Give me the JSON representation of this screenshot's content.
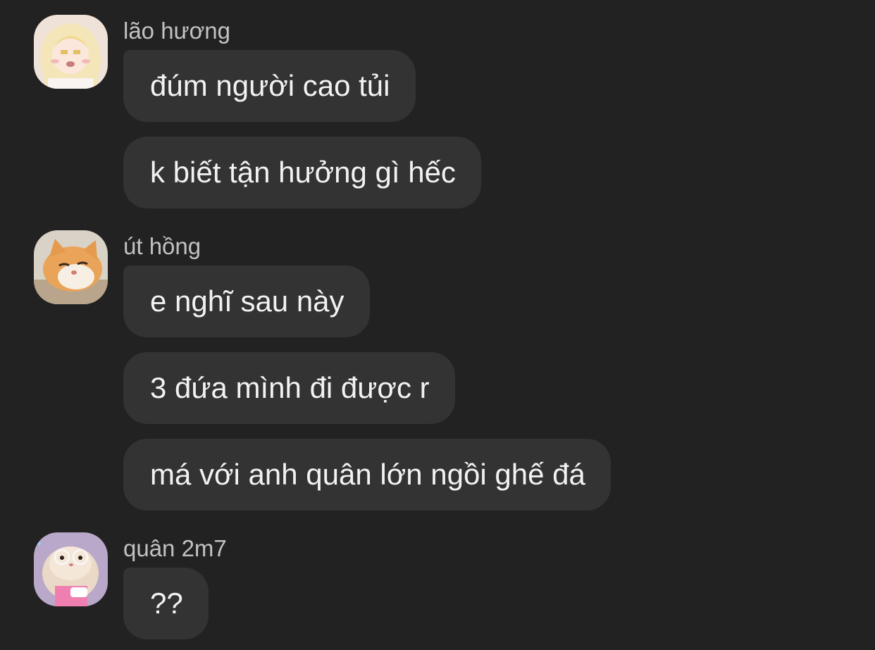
{
  "messages": [
    {
      "sender": "lão hương",
      "avatar": "anime-girl-avatar",
      "bubbles": [
        "đúm người cao tủi",
        "k biết tận hưởng gì hếc"
      ]
    },
    {
      "sender": "út hồng",
      "avatar": "orange-cat-avatar",
      "bubbles": [
        "e nghĩ sau này",
        "3 đứa mình đi được r",
        "má với anh quân lớn ngồi ghế đá"
      ]
    },
    {
      "sender": "quân 2m7",
      "avatar": "hamster-glasses-avatar",
      "bubbles": [
        "??"
      ]
    }
  ],
  "colors": {
    "background": "#222222",
    "bubble": "#333333",
    "text": "#f2f2f2",
    "sender": "#c2c2c2"
  }
}
